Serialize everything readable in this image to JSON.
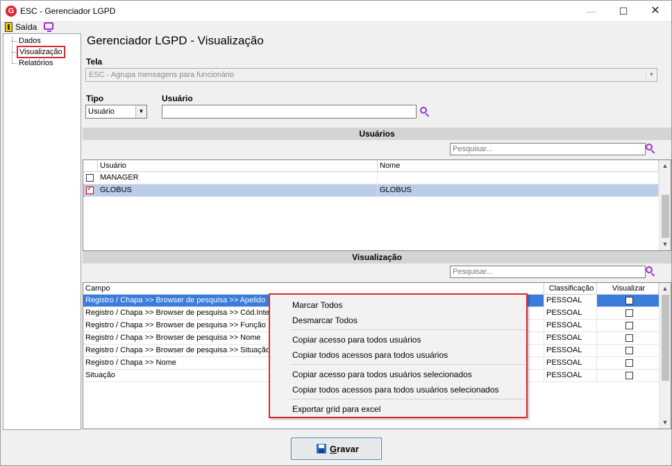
{
  "window": {
    "app_icon_letter": "G",
    "title": "ESC - Gerenciador LGPD",
    "minimize_symbol": "—",
    "maximize_symbol": "☐",
    "close_symbol": "✕"
  },
  "menubar": {
    "exit_label": "Saída",
    "exit_icon": "door-exit-icon",
    "monitor_icon": "monitor-icon"
  },
  "tree": {
    "items": [
      {
        "label": "Dados",
        "selected": false
      },
      {
        "label": "Visualização",
        "selected": true
      },
      {
        "label": "Relatórios",
        "selected": false
      }
    ]
  },
  "main": {
    "title": "Gerenciador LGPD - Visualização",
    "tela_label": "Tela",
    "tela_value": "ESC - Agrupa mensagens para funcionário",
    "tipo_label": "Tipo",
    "tipo_value": "Usuário",
    "usuario_label": "Usuário",
    "usuario_value": ""
  },
  "usuarios_section": {
    "title": "Usuários",
    "search_placeholder": "Pesquisar...",
    "columns": [
      "Usuário",
      "Nome"
    ],
    "rows": [
      {
        "checked": false,
        "usuario": "MANAGER",
        "nome": ""
      },
      {
        "checked": true,
        "usuario": "GLOBUS",
        "nome": "GLOBUS"
      }
    ]
  },
  "visualizacao_section": {
    "title": "Visualização",
    "search_placeholder": "Pesquisar...",
    "columns": [
      "Campo",
      "Classificação",
      "Visualizar"
    ],
    "rows": [
      {
        "campo": "Registro / Chapa >> Browser de pesquisa >> Apelido",
        "classificacao": "PESSOAL",
        "visualizar": false
      },
      {
        "campo": "Registro / Chapa >> Browser de pesquisa >> Cód.Interno",
        "classificacao": "PESSOAL",
        "visualizar": false
      },
      {
        "campo": "Registro / Chapa >> Browser de pesquisa >> Função",
        "classificacao": "PESSOAL",
        "visualizar": false
      },
      {
        "campo": "Registro / Chapa >> Browser de pesquisa >> Nome",
        "classificacao": "PESSOAL",
        "visualizar": false
      },
      {
        "campo": "Registro / Chapa >> Browser de pesquisa >> Situação",
        "classificacao": "PESSOAL",
        "visualizar": false
      },
      {
        "campo": "Registro / Chapa >> Nome",
        "classificacao": "PESSOAL",
        "visualizar": false
      },
      {
        "campo": "Situação",
        "classificacao": "PESSOAL",
        "visualizar": false
      }
    ]
  },
  "context_menu": {
    "items": [
      "Marcar Todos",
      "Desmarcar Todos",
      "Copiar acesso para todos usuários",
      "Copiar todos acessos para todos usuários",
      "Copiar acesso para todos usuários selecionados",
      "Copiar todos acessos para todos usuários selecionados",
      "Exportar grid para excel"
    ]
  },
  "footer": {
    "save_label_underlined": "G",
    "save_label_rest": "ravar",
    "save_icon": "floppy-disk-icon"
  },
  "colors": {
    "selection_blue": "#3b7ddd",
    "highlight_red": "#e0262b",
    "accent_purple": "#9a2fd2"
  }
}
